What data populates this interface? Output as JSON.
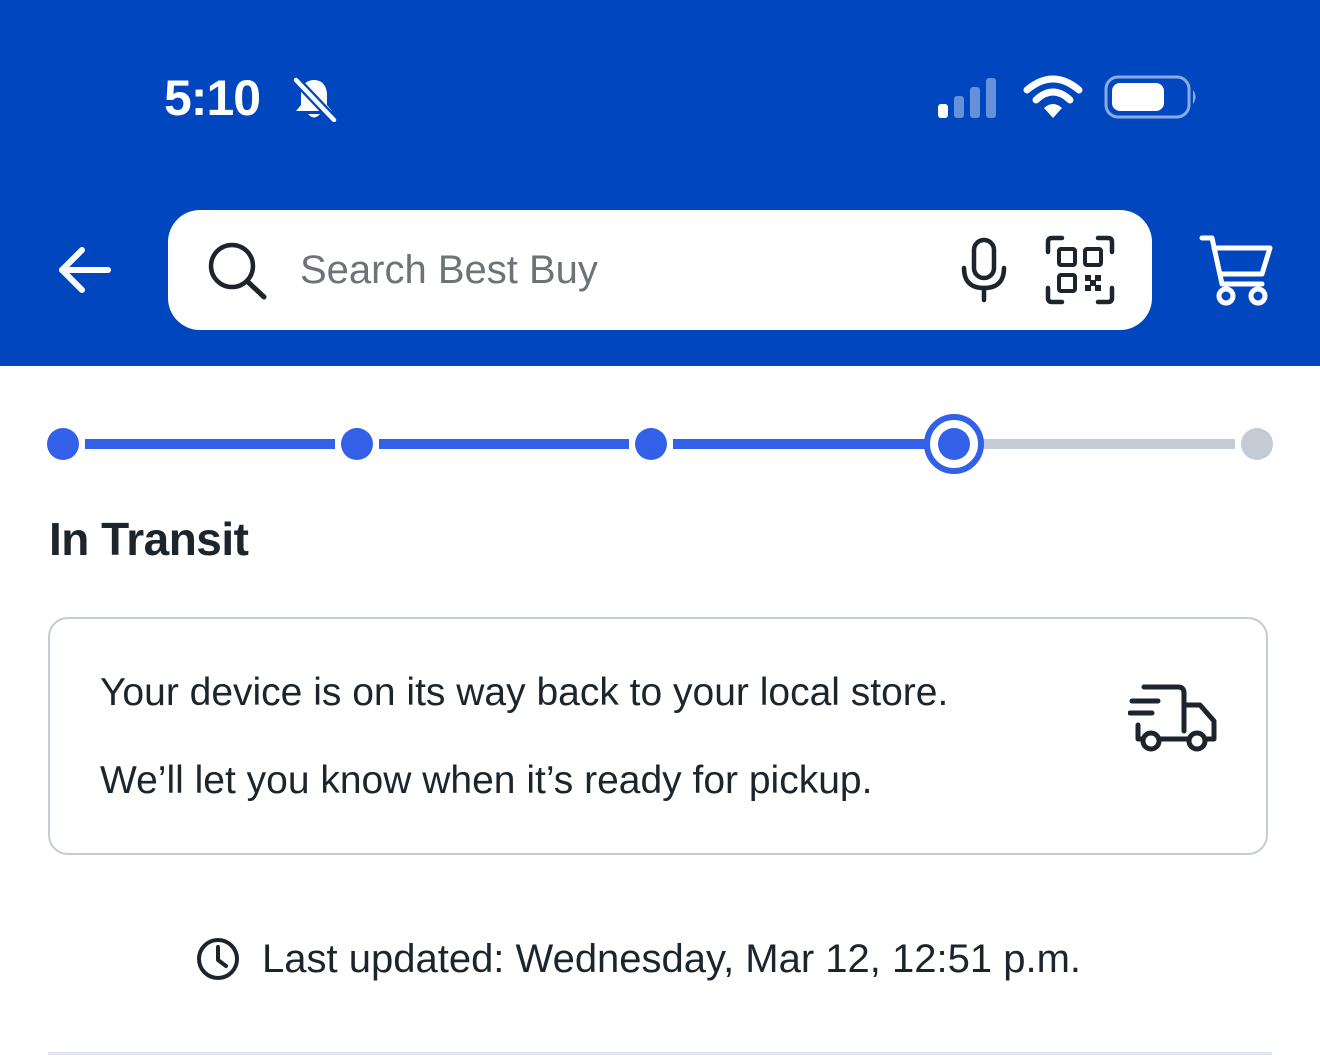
{
  "status_bar": {
    "time": "5:10"
  },
  "search": {
    "placeholder": "Search Best Buy"
  },
  "progress": {
    "total_steps": 5,
    "current_step": 4,
    "active_color": "#3260e8",
    "inactive_color": "#c5cbd5"
  },
  "status": {
    "title": "In Transit",
    "message_line1": "Your device is on its way back to your local store.",
    "message_line2": "We’ll let you know when it’s ready for pickup."
  },
  "updated": {
    "text": "Last updated: Wednesday, Mar 12, 12:51 p.m."
  },
  "icons": {
    "back": "back-arrow-icon",
    "search": "search-icon",
    "microphone": "microphone-icon",
    "scanner": "qr-code-scanner-icon",
    "cart": "cart-icon",
    "truck": "delivery-truck-icon",
    "clock": "clock-icon",
    "mute": "bell-slash-icon",
    "signal": "cellular-signal-icon",
    "wifi": "wifi-icon",
    "battery": "battery-icon"
  },
  "colors": {
    "brand_blue": "#0046be",
    "text_dark": "#1d252c"
  }
}
